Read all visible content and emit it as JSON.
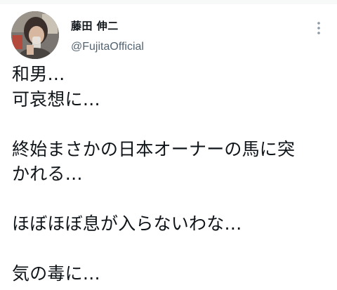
{
  "author": {
    "display_name": "藤田 伸二",
    "handle": "@FujitaOfficial",
    "avatar": "profile-photo"
  },
  "menu": {
    "icon": "more-vertical-icon"
  },
  "tweet": {
    "lines": [
      "和男…",
      "可哀想に…",
      "",
      "終始まさかの日本オーナーの馬に突",
      "かれる…",
      "",
      "ほぼほぼ息が入らないわな…",
      "",
      "気の毒に…"
    ]
  },
  "colors": {
    "text": "#0f1419",
    "secondary": "#536471",
    "background": "#ffffff"
  }
}
